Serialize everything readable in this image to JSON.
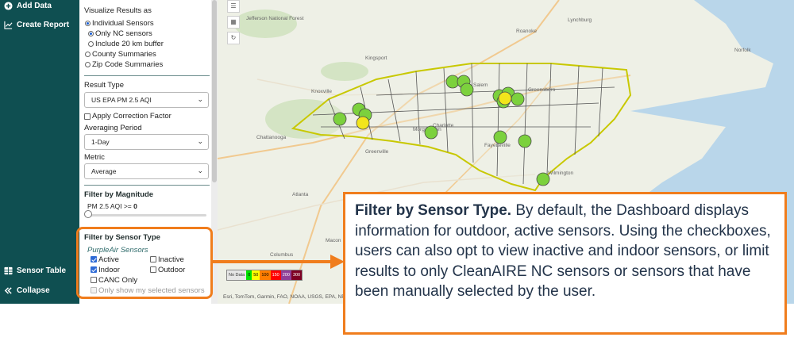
{
  "nav": {
    "add_data": "Add Data",
    "create_report": "Create Report",
    "sensor_table": "Sensor Table",
    "collapse": "Collapse"
  },
  "panel": {
    "visualize_title": "Visualize Results as",
    "opt_individual": "Individual Sensors",
    "opt_only_nc": "Only NC sensors",
    "opt_buffer": "Include 20 km buffer",
    "opt_county": "County Summaries",
    "opt_zip": "Zip Code Summaries",
    "result_type_label": "Result Type",
    "result_type_value": "US EPA PM 2.5 AQI",
    "apply_correction": "Apply Correction Factor",
    "averaging_label": "Averaging Period",
    "averaging_value": "1-Day",
    "metric_label": "Metric",
    "metric_value": "Average",
    "filter_magnitude_title": "Filter by Magnitude",
    "magnitude_label": "PM 2.5 AQI >=",
    "magnitude_value": "0",
    "filter_sensor_type_title": "Filter by Sensor Type",
    "purpleair_label": "PurpleAir Sensors",
    "cb_active": "Active",
    "cb_inactive": "Inactive",
    "cb_indoor": "Indoor",
    "cb_outdoor": "Outdoor",
    "cb_canc": "CANC Only",
    "cb_selected": "Only show my selected sensors"
  },
  "map": {
    "labels": {
      "lynchburg": "Lynchburg",
      "knoxville": "Knoxville",
      "salem": "Salem",
      "charlotte": "Charlotte",
      "atlanta": "Atlanta",
      "chattanooga": "Chattanooga",
      "greenville": "Greenville",
      "columbus": "Columbus",
      "norfolk": "Norfolk",
      "wilmington": "Wilmington",
      "national_forest": "Jefferson National Forest",
      "kingsport": "Kingsport",
      "greensboro": "Greensboro",
      "fayetteville": "Fayetteville",
      "morgantown": "Morgantown",
      "roanoke": "Roanoke",
      "macon": "Macon"
    },
    "legend": [
      "No Data",
      "0",
      "50",
      "100",
      "150",
      "200",
      "300"
    ],
    "attribution": "Esri, TomTom, Garmin, FAO, NOAA, USGS, EPA, NPS"
  },
  "callout": {
    "title": "Filter by Sensor Type.",
    "text": "By default, the Dashboard displays information for outdoor, active sensors. Using the checkboxes, users can also opt to view inactive and indoor sensors, or limit results to only CleanAIRE NC sensors or sensors that have been manually selected by the user."
  },
  "colors": {
    "nav_bg": "#0f4f51",
    "accent_orange": "#f07d1d",
    "sensor_good": "#7cd13d",
    "sensor_moderate": "#f2e51c",
    "nc_outline": "#c8c800"
  }
}
